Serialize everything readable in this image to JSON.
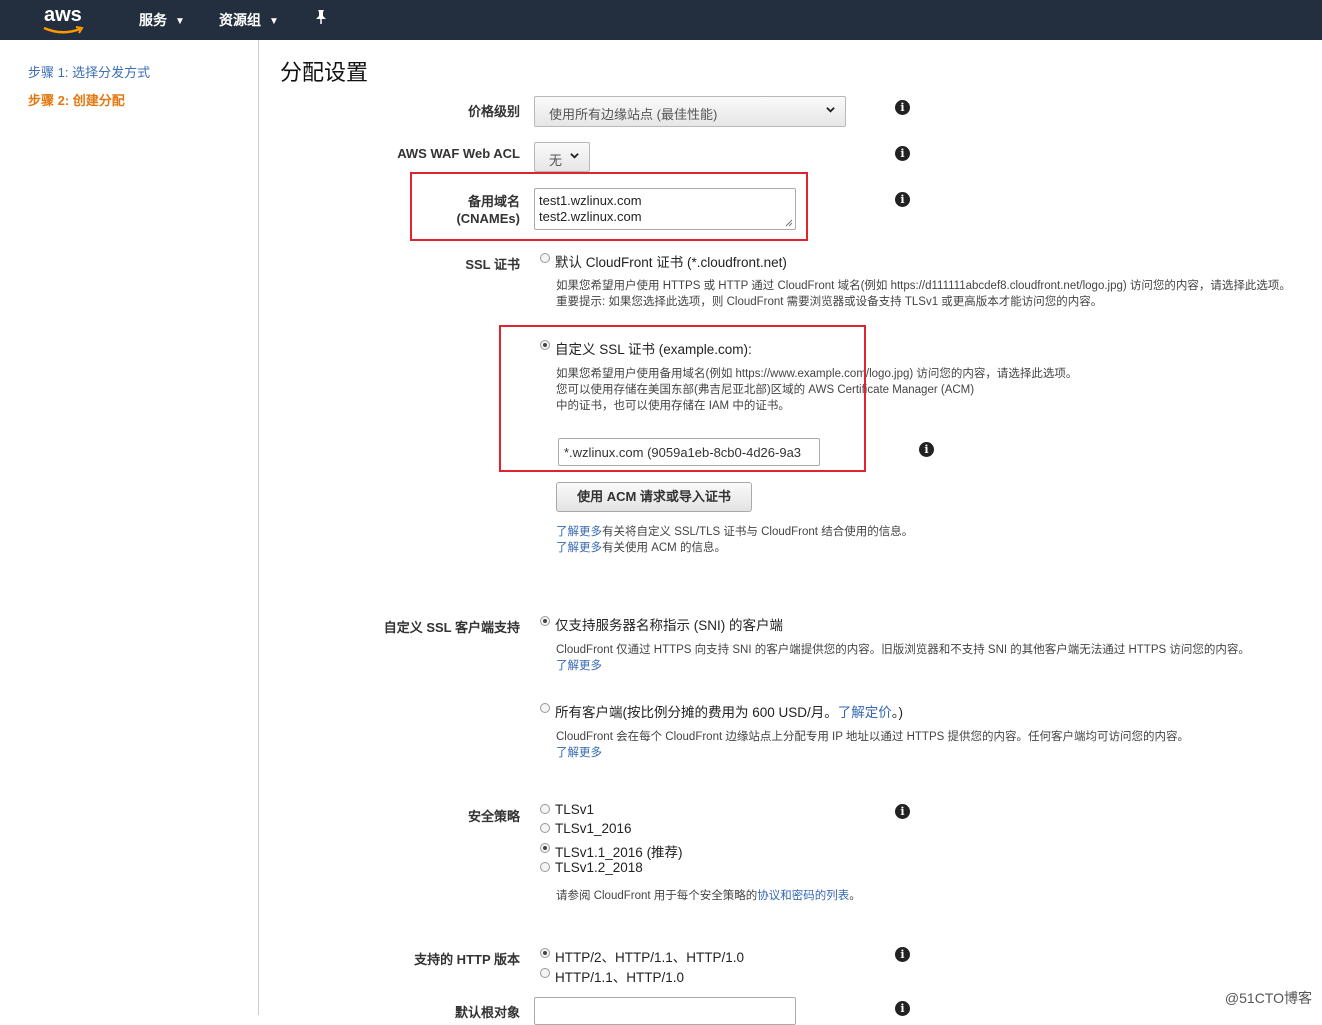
{
  "nav": {
    "logo_text": "aws",
    "services": "服务",
    "resource_groups": "资源组",
    "pin_icon": "pushpin-icon"
  },
  "sidebar": {
    "step1": "步骤 1: 选择分发方式",
    "step2": "步骤 2: 创建分配"
  },
  "page_title": "分配设置",
  "price_class": {
    "label": "价格级别",
    "value": "使用所有边缘站点 (最佳性能)"
  },
  "waf": {
    "label": "AWS WAF Web ACL",
    "value": "无"
  },
  "cnames": {
    "label_line1": "备用域名",
    "label_line2": "(CNAMEs)",
    "line1": "test1.wzlinux.com",
    "line2": "test2.wzlinux.com"
  },
  "ssl": {
    "label": "SSL 证书",
    "default_option": "默认 CloudFront 证书 (*.cloudfront.net)",
    "default_help1": "如果您希望用户使用 HTTPS 或 HTTP 通过 CloudFront 域名(例如 https://d111111abcdef8.cloudfront.net/logo.jpg) 访问您的内容，请选择此选项。",
    "default_help2": "重要提示: 如果您选择此选项，则 CloudFront 需要浏览器或设备支持 TLSv1 或更高版本才能访问您的内容。",
    "custom_option": "自定义 SSL 证书 (example.com):",
    "custom_help1": "如果您希望用户使用备用域名(例如 https://www.example.com/logo.jpg) 访问您的内容，请选择此选项。",
    "custom_help2": "您可以使用存储在美国东部(弗吉尼亚北部)区域的 AWS Certificate Manager (ACM)",
    "custom_help3": "中的证书，也可以使用存储在 IAM 中的证书。",
    "cert_value": "*.wzlinux.com (9059a1eb-8cb0-4d26-9a3",
    "acm_button": "使用 ACM 请求或导入证书",
    "learn_more": "了解更多",
    "learn1_rest": "有关将自定义 SSL/TLS 证书与 CloudFront 结合使用的信息。",
    "learn2_rest": "有关使用 ACM 的信息。"
  },
  "client_support": {
    "label": "自定义 SSL 客户端支持",
    "sni_option": "仅支持服务器名称指示 (SNI) 的客户端",
    "sni_help": "CloudFront 仅通过 HTTPS 向支持 SNI 的客户端提供您的内容。旧版浏览器和不支持 SNI 的其他客户端无法通过 HTTPS 访问您的内容。",
    "learn_more": "了解更多",
    "all_option_prefix": "所有客户端(按比例分摊的费用为 600 USD/月。",
    "all_option_link": "了解定价",
    "all_option_suffix": "。)",
    "all_help": "CloudFront 会在每个 CloudFront 边缘站点上分配专用 IP 地址以通过 HTTPS 提供您的内容。任何客户端均可访问您的内容。"
  },
  "security_policy": {
    "label": "安全策略",
    "options": [
      "TLSv1",
      "TLSv1_2016",
      "TLSv1.1_2016 (推荐)",
      "TLSv1.2_2018"
    ],
    "selected_index": 2,
    "help_prefix": "请参阅 CloudFront 用于每个安全策略的",
    "help_link": "协议和密码的列表",
    "help_suffix": "。"
  },
  "http_versions": {
    "label": "支持的 HTTP 版本",
    "options": [
      "HTTP/2、HTTP/1.1、HTTP/1.0",
      "HTTP/1.1、HTTP/1.0"
    ],
    "selected_index": 0
  },
  "default_root": {
    "label": "默认根对象"
  },
  "watermark": "@51CTO博客"
}
